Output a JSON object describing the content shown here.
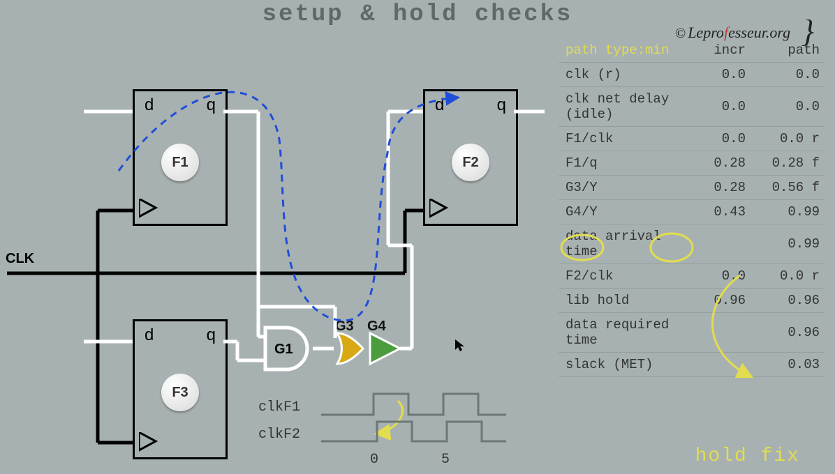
{
  "title": "setup & hold checks",
  "credit": {
    "copyright": "©",
    "name_pre": "Lepro",
    "name_f": "f",
    "name_post": "esseur.org",
    "brace": "}"
  },
  "clk_label": "CLK",
  "ff": {
    "F1": {
      "d": "d",
      "q": "q",
      "name": "F1"
    },
    "F2": {
      "d": "d",
      "q": "q",
      "name": "F2"
    },
    "F3": {
      "d": "d",
      "q": "q",
      "name": "F3"
    }
  },
  "gates": {
    "G1": "G1",
    "G3": "G3",
    "G4": "G4"
  },
  "wave": {
    "lblF1": "clkF1",
    "lblF2": "clkF2",
    "tick0": "0",
    "tick1": "5"
  },
  "hold_fix": "hold fix",
  "table": {
    "hdr_path": "path type:min",
    "hdr_incr": "incr",
    "hdr_pathcol": "path",
    "rows": [
      {
        "name": "clk (r)",
        "incr": "0.0",
        "path": "0.0"
      },
      {
        "name": "clk net delay (idle)",
        "incr": "0.0",
        "path": "0.0"
      },
      {
        "name": "F1/clk",
        "incr": "0.0",
        "path": "0.0 r"
      },
      {
        "name": "F1/q",
        "incr": "0.28",
        "path": "0.28 f"
      },
      {
        "name": "G3/Y",
        "incr": "0.28",
        "path": "0.56 f"
      },
      {
        "name": "G4/Y",
        "incr": "0.43",
        "path": "0.99"
      },
      {
        "name": "data arrival time",
        "incr": "",
        "path": "0.99"
      },
      {
        "name": "F2/clk",
        "incr": "0.0",
        "path": "0.0 r"
      },
      {
        "name": "lib hold",
        "incr": "0.96",
        "path": "0.96"
      },
      {
        "name": "data required time",
        "incr": "",
        "path": "0.96"
      },
      {
        "name": "slack (MET)",
        "incr": "",
        "path": "0.03"
      }
    ]
  }
}
